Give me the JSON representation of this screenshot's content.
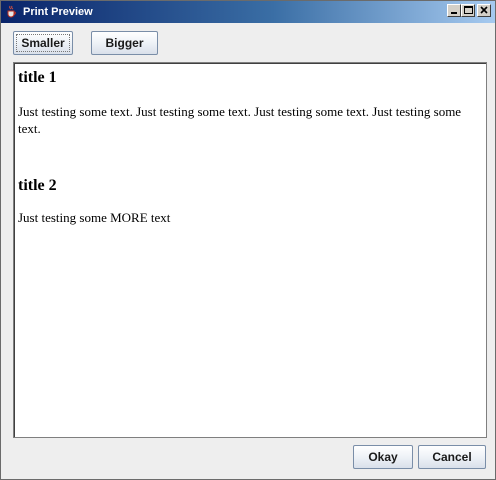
{
  "window": {
    "title": "Print Preview",
    "controls": {
      "minimize_icon": "minimize-icon",
      "maximize_icon": "maximize-icon",
      "close_icon": "close-icon"
    }
  },
  "toolbar": {
    "smaller_label": "Smaller",
    "bigger_label": "Bigger"
  },
  "document": {
    "sections": [
      {
        "title": "title 1",
        "body": "Just testing some text. Just testing some text. Just testing some text. Just testing some text."
      },
      {
        "title": "title 2",
        "body": "Just testing some MORE text"
      }
    ]
  },
  "footer": {
    "okay_label": "Okay",
    "cancel_label": "Cancel"
  },
  "colors": {
    "titlebar_start": "#0a246a",
    "titlebar_end": "#a6caf0",
    "window_bg": "#eeeeee",
    "preview_bg": "#ffffff"
  }
}
